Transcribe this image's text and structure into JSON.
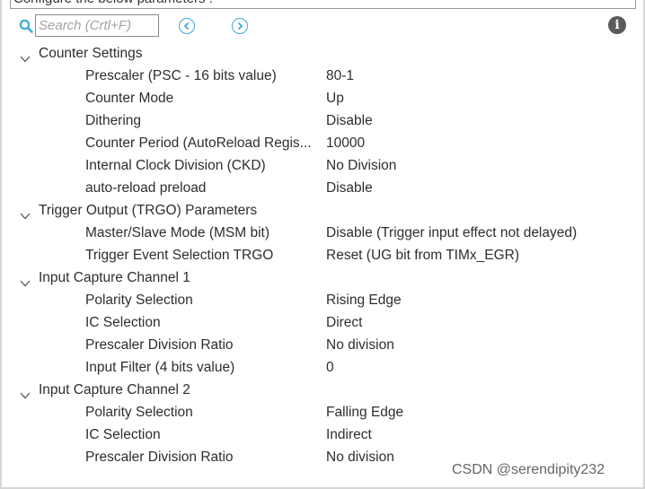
{
  "header": {
    "banner_text": "Configure the below parameters :"
  },
  "toolbar": {
    "search_placeholder": "Search (Crtl+F)",
    "prev_icon": "chevron-left-circle-icon",
    "next_icon": "chevron-right-circle-icon",
    "info_icon": "info-icon",
    "info_glyph": "i",
    "accent_color": "#3fa9d7"
  },
  "groups": [
    {
      "title": "Counter Settings",
      "params": [
        {
          "name": "Prescaler (PSC - 16 bits value)",
          "value": "80-1"
        },
        {
          "name": "Counter Mode",
          "value": "Up"
        },
        {
          "name": "Dithering",
          "value": "Disable"
        },
        {
          "name": "Counter Period (AutoReload Regis...",
          "value": "10000"
        },
        {
          "name": "Internal Clock Division (CKD)",
          "value": "No Division"
        },
        {
          "name": "auto-reload preload",
          "value": "Disable"
        }
      ]
    },
    {
      "title": "Trigger Output (TRGO) Parameters",
      "params": [
        {
          "name": "Master/Slave Mode (MSM bit)",
          "value": "Disable (Trigger input effect not delayed)"
        },
        {
          "name": "Trigger Event Selection TRGO",
          "value": "Reset (UG bit from TIMx_EGR)"
        }
      ]
    },
    {
      "title": "Input Capture Channel 1",
      "params": [
        {
          "name": "Polarity Selection",
          "value": "Rising Edge"
        },
        {
          "name": "IC Selection",
          "value": "Direct"
        },
        {
          "name": "Prescaler Division Ratio",
          "value": "No division"
        },
        {
          "name": "Input Filter (4 bits value)",
          "value": "0"
        }
      ]
    },
    {
      "title": "Input Capture Channel 2",
      "params": [
        {
          "name": "Polarity Selection",
          "value": "Falling Edge"
        },
        {
          "name": "IC Selection",
          "value": "Indirect"
        },
        {
          "name": "Prescaler Division Ratio",
          "value": "No division"
        }
      ]
    }
  ],
  "watermark": "CSDN @serendipity232"
}
